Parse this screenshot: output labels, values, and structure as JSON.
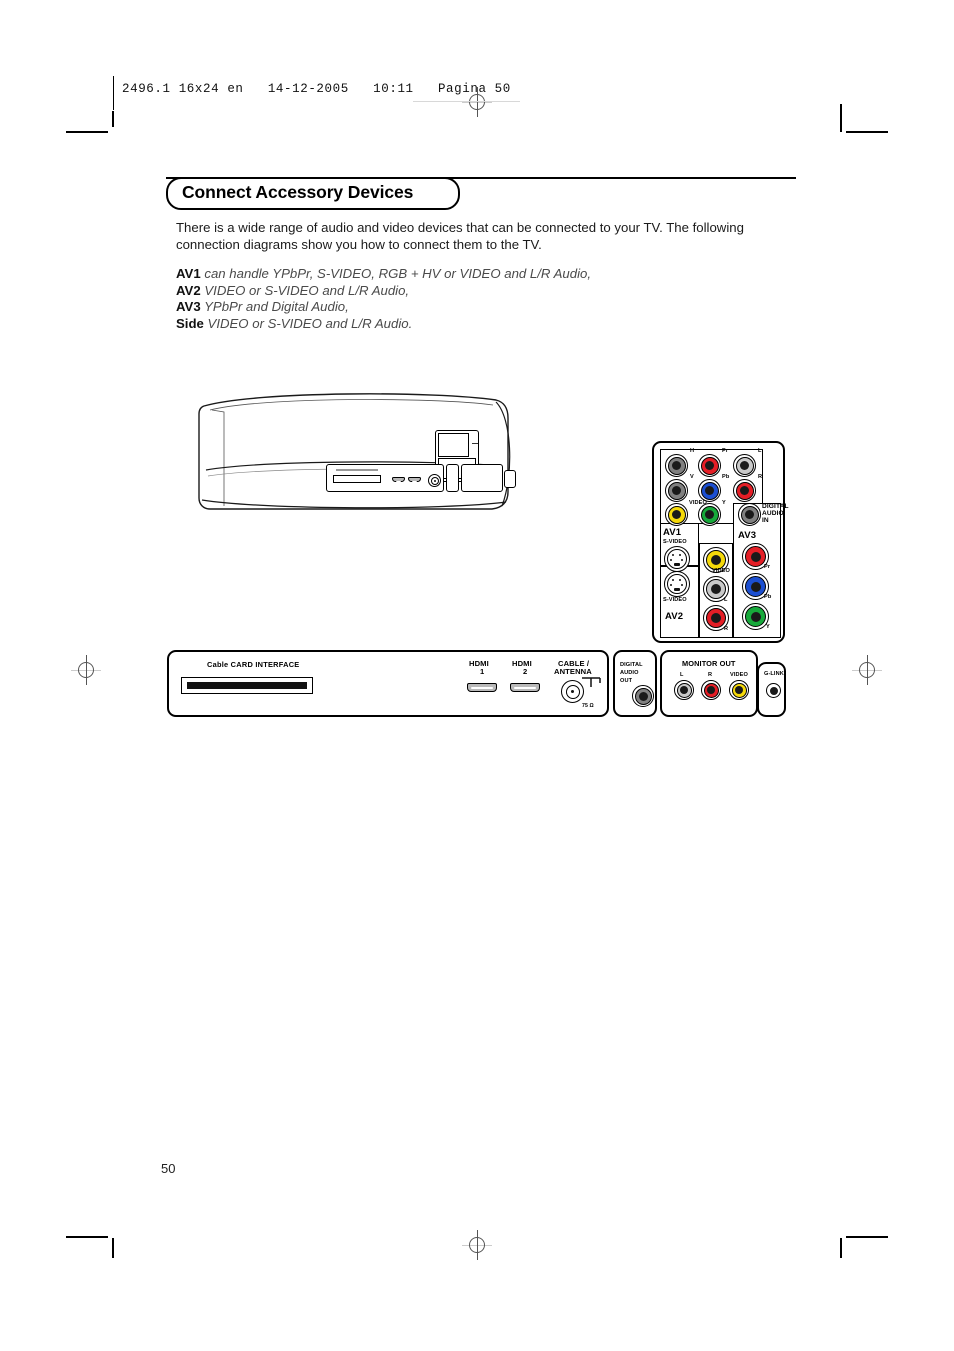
{
  "print_header": {
    "text": "2496.1 16x24 en   14-12-2005   10:11   Pagina 50"
  },
  "title": "Connect Accessory Devices",
  "intro": "There is a wide range of audio and video devices that can be connected to your TV. The following connection diagrams show you how to connect them to the TV.",
  "av_capabilities": [
    {
      "name": "AV1",
      "desc": "can handle YPbPr, S-VIDEO, RGB + HV or VIDEO and L/R Audio,"
    },
    {
      "name": "AV2",
      "desc": "VIDEO or S-VIDEO and L/R Audio,"
    },
    {
      "name": "AV3",
      "desc": "YPbPr and Digital Audio,"
    },
    {
      "name": "Side",
      "desc": "VIDEO or S-VIDEO and L/R Audio."
    }
  ],
  "page_number": "50",
  "rear_panel": {
    "group_labels": {
      "av1": "AV1",
      "av2": "AV2",
      "av3": "AV3",
      "digital_audio_in": "DIGITAL AUDIO IN",
      "digital_audio_in_l1": "DIGITAL",
      "digital_audio_in_l2": "AUDIO",
      "digital_audio_in_l3": "IN",
      "svideo1": "S-VIDEO",
      "svideo2": "S-VIDEO"
    },
    "av1_jacks": [
      {
        "label": "H",
        "color": "#808080"
      },
      {
        "label": "Pr",
        "color": "#e41e26"
      },
      {
        "label": "L",
        "color": "#c9c9c9"
      },
      {
        "label": "V",
        "color": "#808080"
      },
      {
        "label": "Pb",
        "color": "#1c4fd1"
      },
      {
        "label": "R",
        "color": "#e41e26"
      },
      {
        "label": "VIDEO",
        "color": "#f5d90a"
      },
      {
        "label": "Y",
        "color": "#17a93b"
      }
    ],
    "av2_jacks": [
      {
        "label": "VIDEO",
        "color": "#f5d90a"
      },
      {
        "label": "L",
        "color": "#c9c9c9"
      },
      {
        "label": "R",
        "color": "#e41e26"
      }
    ],
    "av3_jacks": [
      {
        "label": "Pr",
        "color": "#e41e26"
      },
      {
        "label": "Pb",
        "color": "#1c4fd1"
      },
      {
        "label": "Y",
        "color": "#17a93b"
      }
    ],
    "digital_audio_in_jack": {
      "label": "",
      "color": "#808080"
    }
  },
  "bottom_panel": {
    "cable_card_label": "Cable CARD INTERFACE",
    "hdmi1_l1": "HDMI",
    "hdmi1_l2": "1",
    "hdmi2_l1": "HDMI",
    "hdmi2_l2": "2",
    "cable_antenna_l1": "CABLE /",
    "cable_antenna_l2": "ANTENNA",
    "impedance": "75 Ω"
  },
  "digital_audio_out": {
    "l1": "DIGITAL",
    "l2": "AUDIO",
    "l3": "OUT",
    "jack_color": "#808080"
  },
  "monitor_out": {
    "title": "MONITOR OUT",
    "jacks": [
      {
        "label": "L",
        "color": "#c9c9c9"
      },
      {
        "label": "R",
        "color": "#e41e26"
      },
      {
        "label": "VIDEO",
        "color": "#f5d90a"
      }
    ]
  },
  "g_link": {
    "label": "G-LINK"
  }
}
